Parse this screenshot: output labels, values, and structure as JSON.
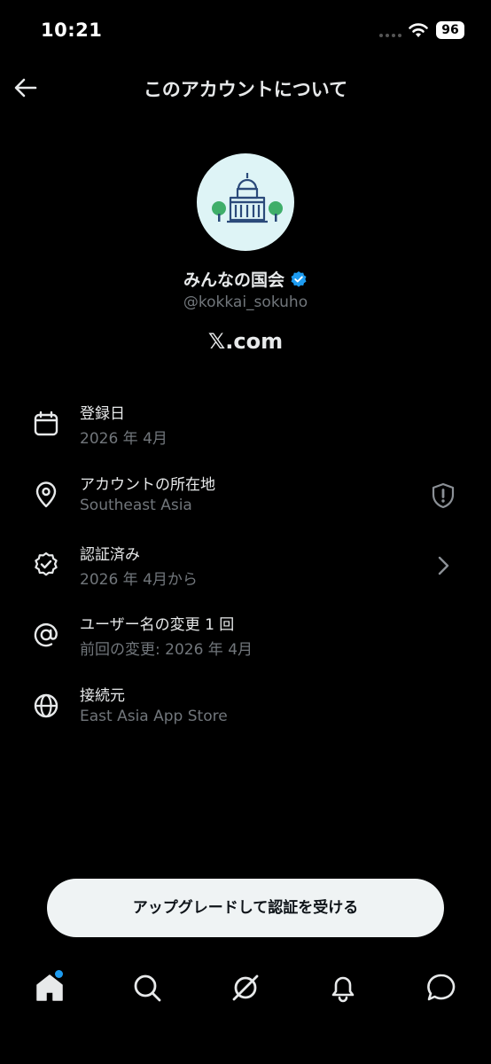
{
  "status_bar": {
    "time": "10:21",
    "battery": "96"
  },
  "header": {
    "title": "このアカウントについて"
  },
  "profile": {
    "display_name": "みんなの国会",
    "handle": "@kokkai_sokuho",
    "site": "𝕏.com"
  },
  "info": [
    {
      "title": "登録日",
      "sub": "2026 年 4月",
      "icon": "calendar-icon"
    },
    {
      "title": "アカウントの所在地",
      "sub": "Southeast Asia",
      "icon": "location-pin-icon",
      "right_icon": "shield-alert-icon"
    },
    {
      "title": "認証済み",
      "sub": "2026 年 4月から",
      "icon": "verified-badge-icon",
      "right_icon": "chevron-right-icon"
    },
    {
      "title": "ユーザー名の変更 1 回",
      "sub": "前回の変更: 2026 年 4月",
      "icon": "at-sign-icon"
    },
    {
      "title": "接続元",
      "sub": "East Asia App Store",
      "icon": "globe-icon"
    }
  ],
  "cta": {
    "label": "アップグレードして認証を受ける"
  },
  "nav": [
    "home-icon",
    "search-icon",
    "grok-icon",
    "notifications-icon",
    "messages-icon"
  ],
  "colors": {
    "background": "#000000",
    "verified": "#1d9bf0",
    "secondary_text": "#71767b",
    "cta_bg": "#eff3f4"
  }
}
